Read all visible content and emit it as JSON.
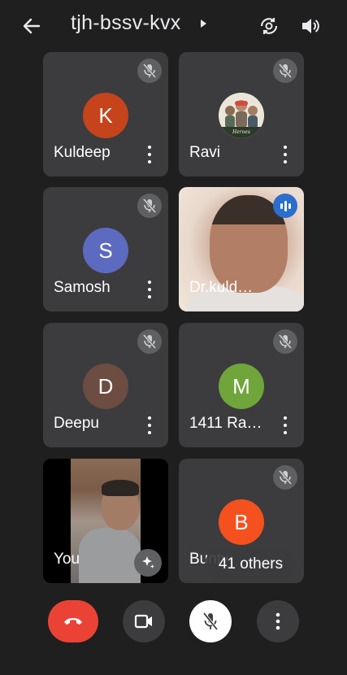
{
  "header": {
    "meeting_code": "tjh-bssv-kvx",
    "icons": [
      "back-arrow-icon",
      "camera-switch-icon",
      "speaker-icon"
    ]
  },
  "tiles": [
    {
      "name": "Kuldeep",
      "initial": "K",
      "avatar_color": "#c5441b",
      "muted": true
    },
    {
      "name": "Ravi",
      "photo_caption": "Heroes",
      "muted": true
    },
    {
      "name": "Samosh",
      "initial": "S",
      "avatar_color": "#5c6bc0",
      "muted": true
    },
    {
      "name": "Dr.kuld…",
      "video": true,
      "speaking": true
    },
    {
      "name": "Deepu",
      "initial": "D",
      "avatar_color": "#6d4c41",
      "muted": true
    },
    {
      "name": "1411 Ra…",
      "initial": "M",
      "avatar_color": "#6fa53b",
      "muted": false
    },
    {
      "name": "You",
      "video": true,
      "self": true
    },
    {
      "name": "Bunty",
      "initial": "B",
      "avatar_color": "#f4511e",
      "muted": true
    }
  ],
  "others_count_label": "41 others",
  "controls": {
    "icons": [
      "end-call-icon",
      "camera-icon",
      "mic-off-icon",
      "more-options-icon"
    ],
    "end_color": "#ea4335"
  }
}
